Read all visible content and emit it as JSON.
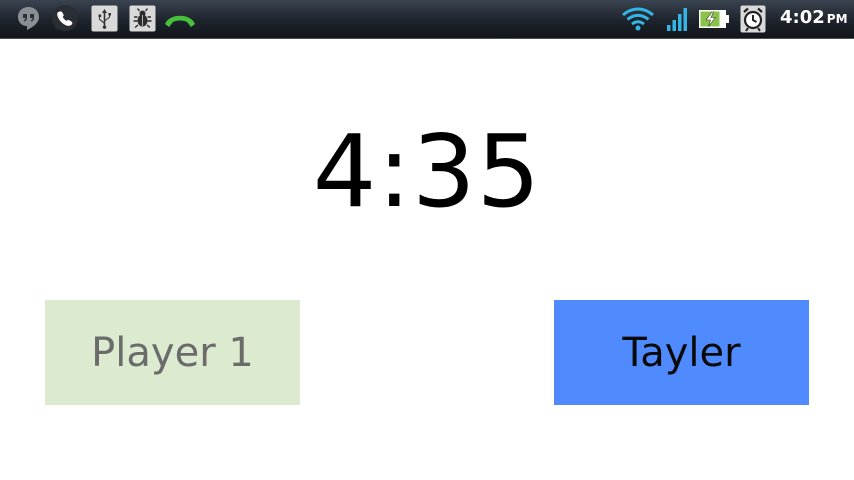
{
  "status_bar": {
    "time": "4:02",
    "ampm": "PM",
    "icons_left": [
      "hangouts-icon",
      "phone-icon",
      "usb-icon",
      "debug-bug-icon",
      "call-in-progress-icon"
    ],
    "icons_right": [
      "wifi-icon",
      "signal-icon",
      "battery-charging-icon",
      "alarm-clock-icon"
    ],
    "colors": {
      "call_green": "#48c03c",
      "wifi_blue": "#33b5e5",
      "battery_green": "#8bc34a"
    }
  },
  "timer": {
    "display": "4:35"
  },
  "players": [
    {
      "label": "Player 1",
      "color": "#dcebd0",
      "active": false
    },
    {
      "label": "Tayler",
      "color": "#4f8bff",
      "active": true
    }
  ]
}
